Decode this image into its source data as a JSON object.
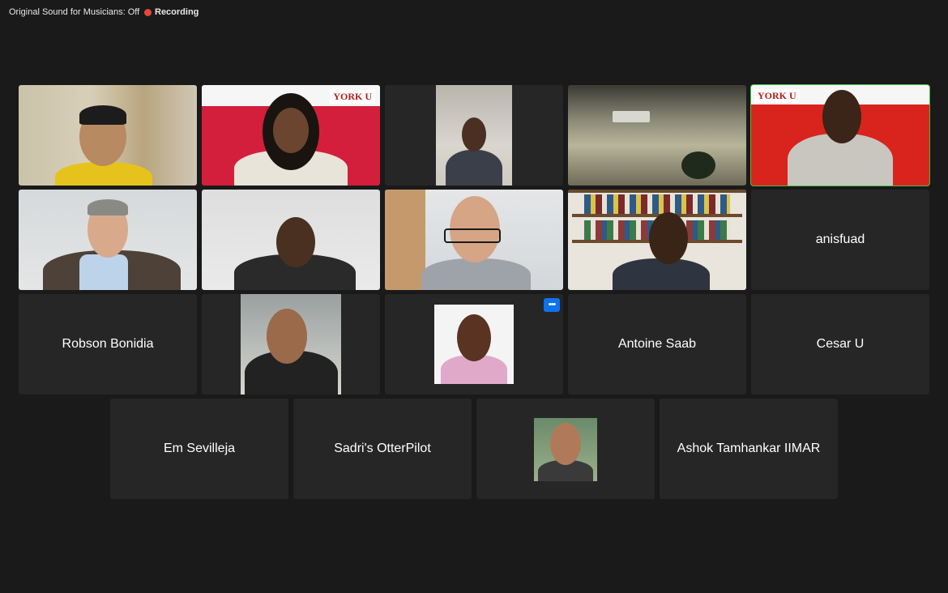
{
  "topbar": {
    "sound_status": "Original Sound for Musicians: Off",
    "recording_label": "Recording"
  },
  "participants": {
    "row2": {
      "anisfuad": "anisfuad"
    },
    "row3": {
      "robson": "Robson Bonidia",
      "antoine": "Antoine Saab",
      "cesar": "Cesar U"
    },
    "row4": {
      "em": "Em Sevilleja",
      "sadri": "Sadri's OtterPilot",
      "ashok": "Ashok Tamhankar IIMAR"
    }
  },
  "logos": {
    "york_left": "YORK U",
    "york_right": "YORK U"
  },
  "colors": {
    "background": "#1a1a1a",
    "tile": "#262626",
    "active_speaker_border": "#3ec53e",
    "recording_dot": "#e8453c",
    "more_button": "#0e72ed"
  },
  "icons": {
    "recording": "recording-dot-icon",
    "more": "more-options-icon"
  }
}
